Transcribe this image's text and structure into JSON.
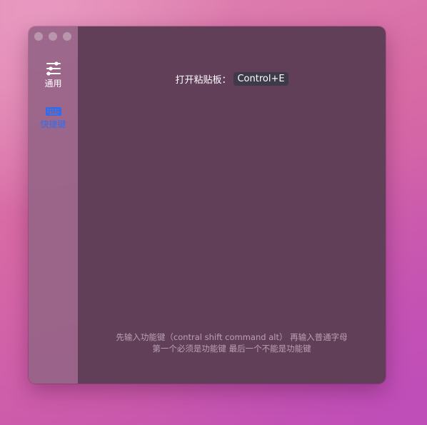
{
  "sidebar": {
    "items": [
      {
        "label": "通用",
        "icon": "sliders-icon",
        "active": false
      },
      {
        "label": "快捷键",
        "icon": "keyboard-icon",
        "active": true
      }
    ]
  },
  "main": {
    "hotkey_label": "打开粘贴板：",
    "hotkey_value": "Control+E",
    "hint_line1": "先输入功能键（contral shift command alt） 再输入普通字母",
    "hint_line2": "第一个必须是功能键 最后一个不能是功能键"
  },
  "colors": {
    "active_accent": "#2f6df0",
    "main_bg": "#613f58",
    "sidebar_bg": "#966487"
  }
}
